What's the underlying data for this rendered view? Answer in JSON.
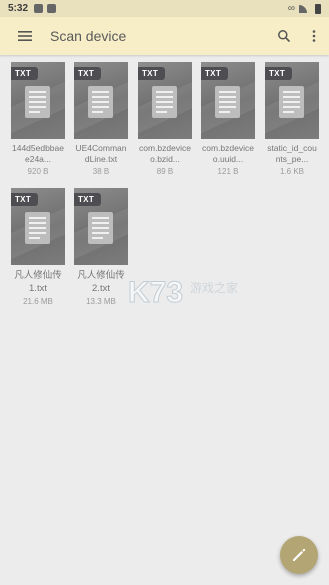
{
  "status_bar": {
    "time": "5:32"
  },
  "appbar": {
    "title": "Scan device"
  },
  "files": [
    {
      "type": "TXT",
      "name": "144d5edbbaee24a...",
      "size": "920 B"
    },
    {
      "type": "TXT",
      "name": "UE4CommandLine.txt",
      "size": "38 B"
    },
    {
      "type": "TXT",
      "name": "com.bzdeviceo.bzid...",
      "size": "89 B"
    },
    {
      "type": "TXT",
      "name": "com.bzdeviceo.uuid...",
      "size": "121 B"
    },
    {
      "type": "TXT",
      "name": "static_id_counts_pe...",
      "size": "1.6 KB"
    },
    {
      "type": "TXT",
      "name": "凡人修仙传1.txt",
      "size": "21.6 MB"
    },
    {
      "type": "TXT",
      "name": "凡人修仙传2.txt",
      "size": "13.3 MB"
    }
  ],
  "watermark": {
    "logo_text": "K73",
    "subtitle": "游戏之家"
  },
  "colors": {
    "appbar": "#f7eec8",
    "statusbar": "#e9e0bd",
    "fab": "#b3a574",
    "badge": "#4e4e52"
  }
}
